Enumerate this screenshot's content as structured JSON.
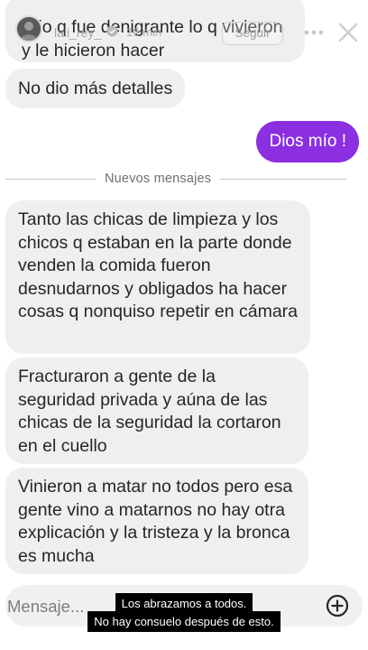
{
  "story": {
    "username": "lali_rey_",
    "time_ago": "16 min",
    "follow_label": "Seguir"
  },
  "messages": [
    {
      "direction": "in",
      "text": "Dijo q fue denigrante lo q vivieron y le hicieron hacer"
    },
    {
      "direction": "in",
      "text": "No dio más detalles"
    },
    {
      "direction": "out",
      "text": "Dios mío !"
    },
    {
      "direction": "in",
      "text": "Tanto las chicas de limpieza y los chicos q estaban en la parte donde venden la comida fueron desnudarnos y obligados ha hacer cosas q nonquiso repetir en cámara"
    },
    {
      "direction": "in",
      "text": "Fracturaron a gente de la seguridad privada y aúna de las chicas de la seguridad la cortaron en el cuello"
    },
    {
      "direction": "in",
      "text": "Vinieron a matar no todos pero esa gente vino a matarnos no hay otra explicación y la tristeza y la bronca es mucha"
    }
  ],
  "divider_label": "Nuevos mensajes",
  "composer": {
    "placeholder": "Mensaje..."
  },
  "captions": [
    "Los abrazamos a todos.",
    "No hay consuelo después de esto."
  ],
  "icons": {
    "more": "more-horizontal-icon",
    "close": "close-icon",
    "plus": "plus-circle-icon",
    "verified": "verified-badge-icon"
  },
  "colors": {
    "outgoing_bubble": "#8b2fe0",
    "incoming_bubble": "#efefef",
    "composer_bg": "#f0f0f0",
    "caption_bg": "#000000"
  }
}
